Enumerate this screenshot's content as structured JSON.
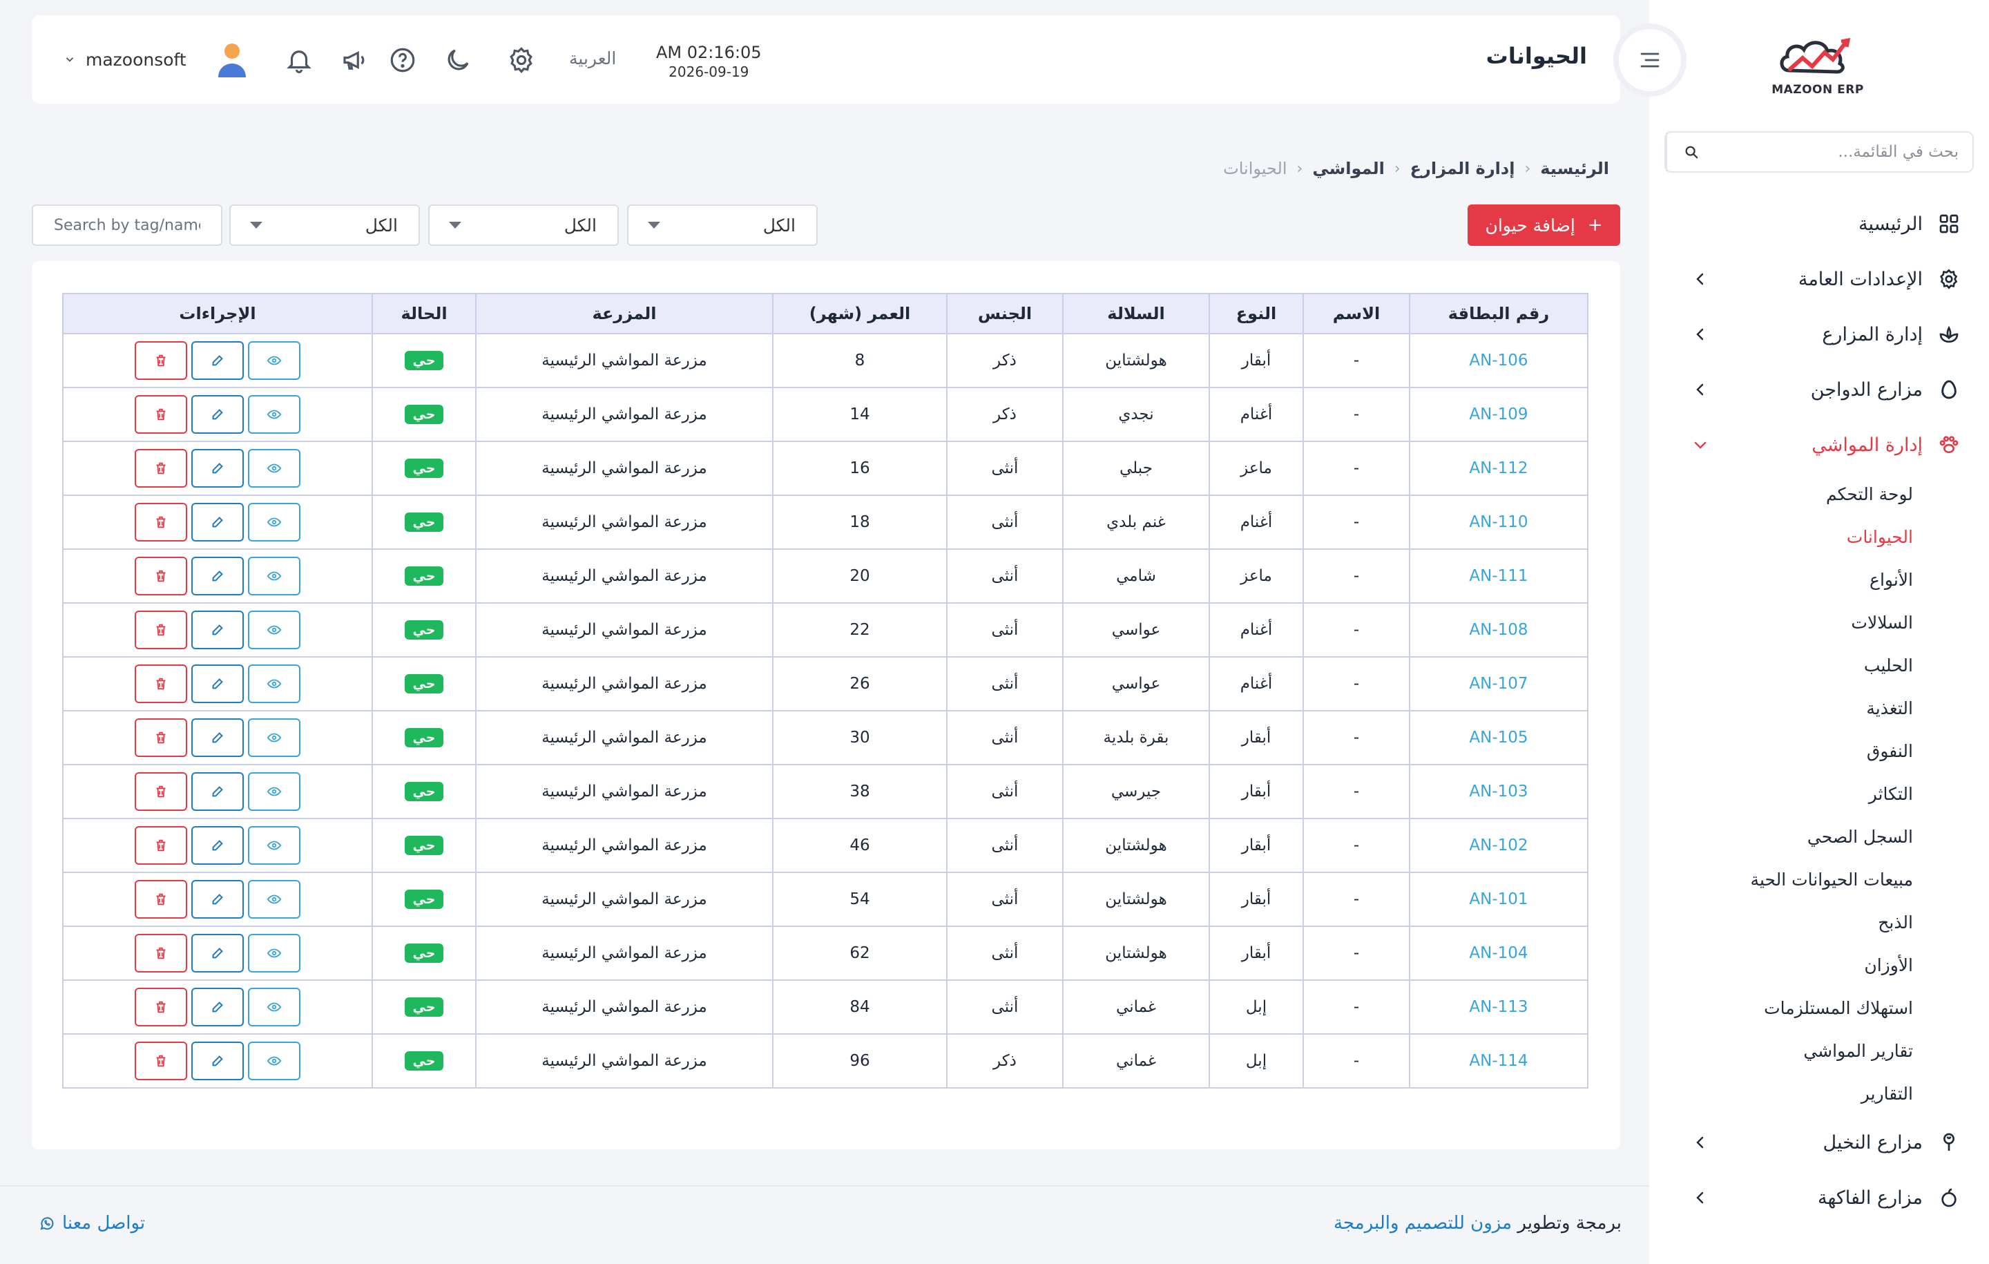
{
  "app": {
    "logo_text": "MAZOON ERP"
  },
  "header": {
    "title": "الحيوانات",
    "time": "AM 02:16:05",
    "date": "2026-09-19",
    "language": "العربية",
    "username": "mazoonsoft",
    "icons": [
      "settings-icon",
      "moon-icon",
      "help-icon",
      "megaphone-icon",
      "bell-icon"
    ]
  },
  "sidebar": {
    "search_placeholder": "بحث في القائمة...",
    "items": [
      {
        "label": "الرئيسية",
        "icon": "grid-icon",
        "has_children": false
      },
      {
        "label": "الإعدادات العامة",
        "icon": "gear-icon",
        "has_children": true
      },
      {
        "label": "إدارة المزارع",
        "icon": "plant-icon",
        "has_children": true
      },
      {
        "label": "مزارع الدواجن",
        "icon": "egg-icon",
        "has_children": true
      },
      {
        "label": "إدارة المواشي",
        "icon": "paw-icon",
        "has_children": true,
        "expanded": true
      }
    ],
    "sub_items": [
      "لوحة التحكم",
      "الحيوانات",
      "الأنواع",
      "السلالات",
      "الحليب",
      "التغذية",
      "النفوق",
      "التكاثر",
      "السجل الصحي",
      "مبيعات الحيوانات الحية",
      "الذبح",
      "الأوزان",
      "استهلاك المستلزمات",
      "تقارير المواشي",
      "التقارير"
    ],
    "active_sub": 1,
    "bottom_items": [
      {
        "label": "مزارع النخيل",
        "icon": "palm-icon",
        "has_children": true
      },
      {
        "label": "مزارع الفاكهة",
        "icon": "fruit-icon",
        "has_children": true
      }
    ]
  },
  "breadcrumb": [
    "الرئيسية",
    "إدارة المزارع",
    "المواشي",
    "الحيوانات"
  ],
  "filters": {
    "add_button": "إضافة حيوان",
    "select_1": "الكل",
    "select_2": "الكل",
    "select_3": "الكل",
    "search_placeholder": "Search by tag/name"
  },
  "table": {
    "headers": [
      "رقم البطاقة",
      "الاسم",
      "النوع",
      "السلالة",
      "الجنس",
      "العمر (شهر)",
      "المزرعة",
      "الحالة",
      "الإجراءات"
    ],
    "rows": [
      [
        "AN-106",
        "-",
        "أبقار",
        "هولشتاين",
        "ذكر",
        "8",
        "مزرعة المواشي الرئيسية",
        "حي"
      ],
      [
        "AN-109",
        "-",
        "أغنام",
        "نجدي",
        "ذكر",
        "14",
        "مزرعة المواشي الرئيسية",
        "حي"
      ],
      [
        "AN-112",
        "-",
        "ماعز",
        "جبلي",
        "أنثى",
        "16",
        "مزرعة المواشي الرئيسية",
        "حي"
      ],
      [
        "AN-110",
        "-",
        "أغنام",
        "غنم بلدي",
        "أنثى",
        "18",
        "مزرعة المواشي الرئيسية",
        "حي"
      ],
      [
        "AN-111",
        "-",
        "ماعز",
        "شامي",
        "أنثى",
        "20",
        "مزرعة المواشي الرئيسية",
        "حي"
      ],
      [
        "AN-108",
        "-",
        "أغنام",
        "عواسي",
        "أنثى",
        "22",
        "مزرعة المواشي الرئيسية",
        "حي"
      ],
      [
        "AN-107",
        "-",
        "أغنام",
        "عواسي",
        "أنثى",
        "26",
        "مزرعة المواشي الرئيسية",
        "حي"
      ],
      [
        "AN-105",
        "-",
        "أبقار",
        "بقرة بلدية",
        "أنثى",
        "30",
        "مزرعة المواشي الرئيسية",
        "حي"
      ],
      [
        "AN-103",
        "-",
        "أبقار",
        "جيرسي",
        "أنثى",
        "38",
        "مزرعة المواشي الرئيسية",
        "حي"
      ],
      [
        "AN-102",
        "-",
        "أبقار",
        "هولشتاين",
        "أنثى",
        "46",
        "مزرعة المواشي الرئيسية",
        "حي"
      ],
      [
        "AN-101",
        "-",
        "أبقار",
        "هولشتاين",
        "أنثى",
        "54",
        "مزرعة المواشي الرئيسية",
        "حي"
      ],
      [
        "AN-104",
        "-",
        "أبقار",
        "هولشتاين",
        "أنثى",
        "62",
        "مزرعة المواشي الرئيسية",
        "حي"
      ],
      [
        "AN-113",
        "-",
        "إبل",
        "غماني",
        "أنثى",
        "84",
        "مزرعة المواشي الرئيسية",
        "حي"
      ],
      [
        "AN-114",
        "-",
        "إبل",
        "غماني",
        "ذكر",
        "96",
        "مزرعة المواشي الرئيسية",
        "حي"
      ]
    ],
    "row_actions": [
      "view-icon",
      "edit-icon",
      "delete-icon"
    ]
  },
  "footer": {
    "credit_prefix": "برمجة وتطوير",
    "credit_brand": "مزون للتصميم والبرمجة",
    "contact": "تواصل معنا"
  },
  "colors": {
    "accent": "#e53946",
    "link": "#3aa3d8",
    "primary": "#1f7cc4",
    "success": "#1fb85c"
  }
}
